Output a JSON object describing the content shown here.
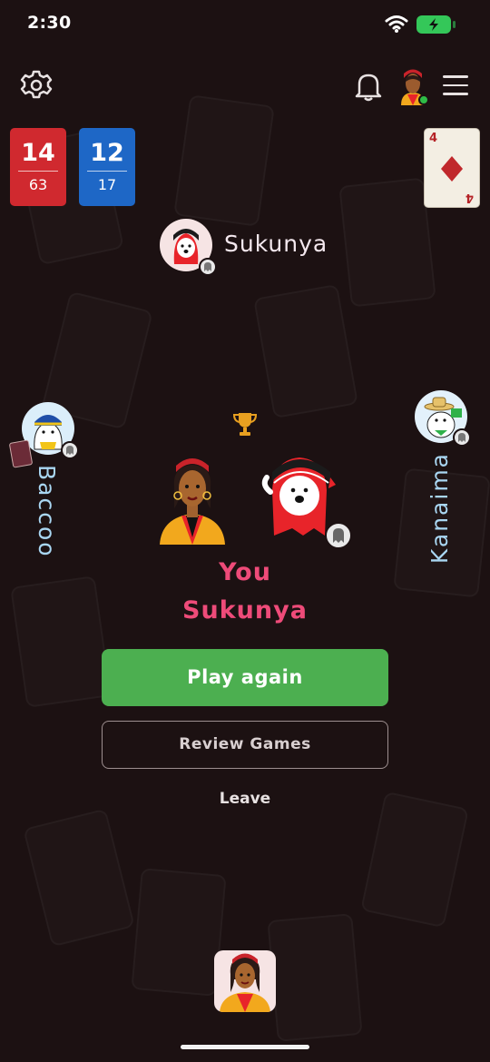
{
  "status_bar": {
    "time": "2:30"
  },
  "scores": [
    {
      "main": "14",
      "sub": "63",
      "color": "#d0292f"
    },
    {
      "main": "12",
      "sub": "17",
      "color": "#1e67c6"
    }
  ],
  "trump_card": {
    "rank": "4",
    "suit": "diamond",
    "color": "#c0282c"
  },
  "players": {
    "top": {
      "name": "Sukunya"
    },
    "left": {
      "name": "Baccoo"
    },
    "right": {
      "name": "Kanaima"
    }
  },
  "result": {
    "winner_line_1": "You",
    "winner_line_2": "Sukunya",
    "winner_color": "#ee4b79"
  },
  "buttons": {
    "play_again": "Play again",
    "review_games": "Review Games",
    "leave": "Leave"
  },
  "colors": {
    "background": "#1c1112",
    "play_button": "#4caf50",
    "trophy": "#e8a020",
    "player_name_light_blue": "#a9d6f2"
  },
  "icons": [
    "gear-icon",
    "bell-icon",
    "hamburger-menu-icon",
    "trophy-icon",
    "ghost-badge-icon"
  ]
}
